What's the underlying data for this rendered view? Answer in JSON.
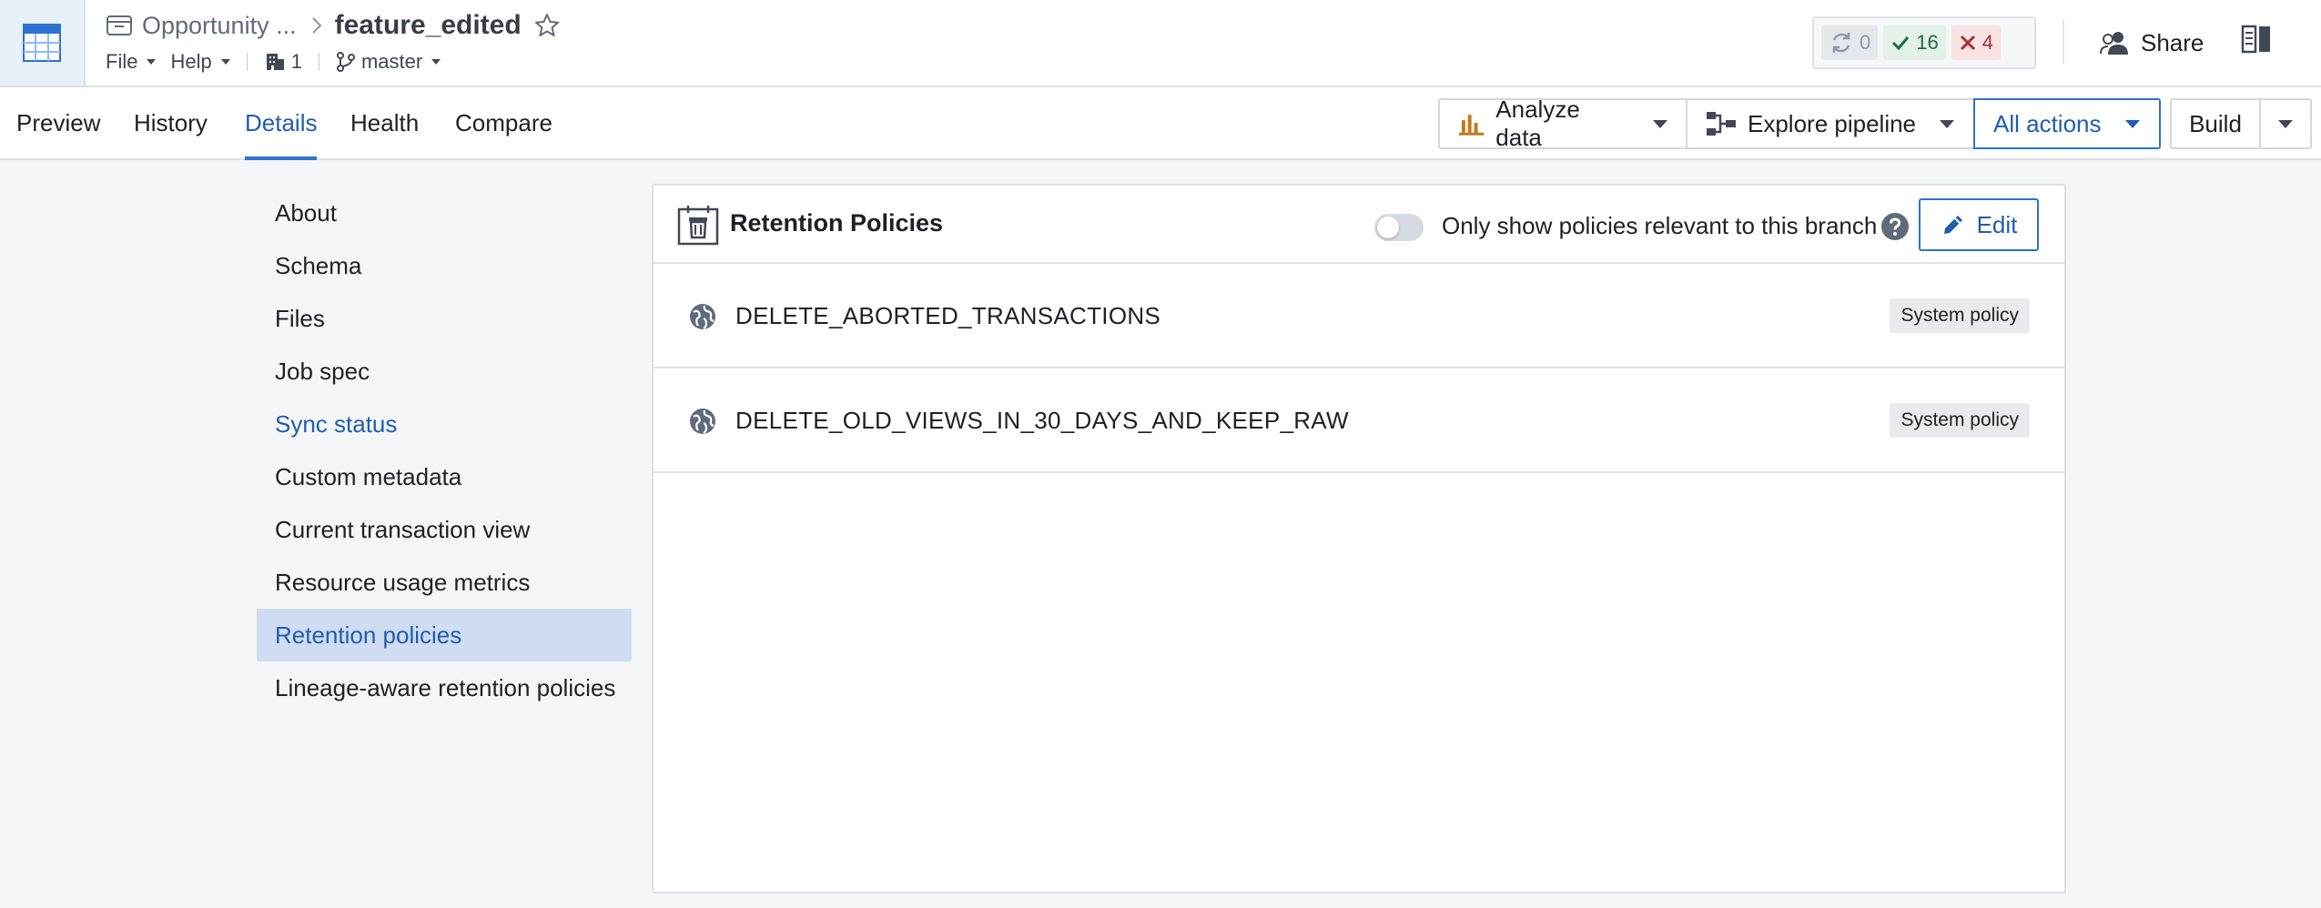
{
  "header": {
    "breadcrumb_folder": "Opportunity ...",
    "title": "feature_edited",
    "menu_file": "File",
    "menu_help": "Help",
    "project_count": "1",
    "branch": "master",
    "status": {
      "running": "0",
      "success": "16",
      "failed": "4"
    },
    "share_label": "Share"
  },
  "tabs": [
    {
      "label": "Preview"
    },
    {
      "label": "History"
    },
    {
      "label": "Details",
      "active": true
    },
    {
      "label": "Health"
    },
    {
      "label": "Compare"
    }
  ],
  "actions": {
    "analyze": "Analyze data",
    "explore": "Explore pipeline",
    "all_actions": "All actions",
    "build": "Build"
  },
  "sidebar": {
    "items": [
      {
        "label": "About"
      },
      {
        "label": "Schema"
      },
      {
        "label": "Files"
      },
      {
        "label": "Job spec"
      },
      {
        "label": "Sync status"
      },
      {
        "label": "Custom metadata"
      },
      {
        "label": "Current transaction view"
      },
      {
        "label": "Resource usage metrics"
      },
      {
        "label": "Retention policies",
        "selected": true
      },
      {
        "label": "Lineage-aware retention policies"
      }
    ]
  },
  "panel": {
    "title": "Retention Policies",
    "toggle_label": "Only show policies relevant to this branch",
    "edit_label": "Edit",
    "policies": [
      {
        "name": "DELETE_ABORTED_TRANSACTIONS",
        "tag": "System policy"
      },
      {
        "name": "DELETE_OLD_VIEWS_IN_30_DAYS_AND_KEEP_RAW",
        "tag": "System policy"
      }
    ]
  },
  "colors": {
    "accent": "#2d72d2",
    "link": "#215db0",
    "selected_bg": "#cfdcf2",
    "analyze_icon": "#c87619"
  }
}
